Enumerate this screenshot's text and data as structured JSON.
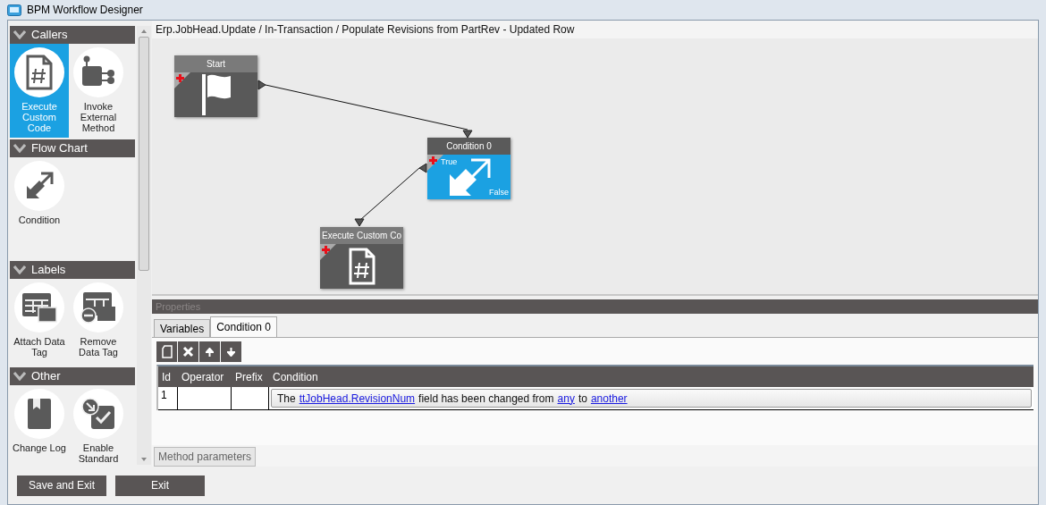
{
  "window": {
    "title": "BPM Workflow Designer"
  },
  "sidebar": {
    "sections": [
      {
        "title": "Callers",
        "items": [
          {
            "label": "Execute Custom Code",
            "kind": "code",
            "selected": true
          },
          {
            "label": "Invoke External Method",
            "kind": "method",
            "selected": false
          }
        ]
      },
      {
        "title": "Flow Chart",
        "items": [
          {
            "label": "Condition",
            "kind": "condition",
            "selected": false
          }
        ]
      },
      {
        "title": "Labels",
        "items": [
          {
            "label": "Attach Data Tag",
            "kind": "attach",
            "selected": false
          },
          {
            "label": "Remove Data Tag",
            "kind": "remove",
            "selected": false
          }
        ]
      },
      {
        "title": "Other",
        "items": [
          {
            "label": "Change Log",
            "kind": "log",
            "selected": false
          },
          {
            "label": "Enable Standard",
            "kind": "enable",
            "selected": false
          }
        ]
      }
    ]
  },
  "breadcrumb": "Erp.JobHead.Update / In-Transaction / Populate Revisions from PartRev - Updated Row",
  "nodes": [
    {
      "title": "Start",
      "kind": "start",
      "selected": false
    },
    {
      "title": "Condition 0",
      "kind": "condition",
      "selected": true,
      "true_label": "True",
      "false_label": "False"
    },
    {
      "title": "Execute Custom Co",
      "kind": "code",
      "selected": false
    }
  ],
  "properties": {
    "title": "Properties",
    "tabs": [
      {
        "label": "Variables",
        "selected": false
      },
      {
        "label": "Condition 0",
        "selected": true
      }
    ],
    "table": {
      "columns": [
        "Id",
        "Operator",
        "Prefix",
        "Condition"
      ],
      "rows": [
        {
          "id": "1",
          "operator": "",
          "prefix": "",
          "condition": [
            {
              "kind": "text",
              "text": "The"
            },
            {
              "kind": "link",
              "text": "ttJobHead.RevisionNum"
            },
            {
              "kind": "text",
              "text": "field has been changed from"
            },
            {
              "kind": "link",
              "text": "any"
            },
            {
              "kind": "text",
              "text": "to"
            },
            {
              "kind": "link",
              "text": "another"
            }
          ]
        }
      ]
    },
    "bottom_tab": "Method parameters"
  },
  "buttons": [
    "Save and Exit",
    "Exit"
  ]
}
